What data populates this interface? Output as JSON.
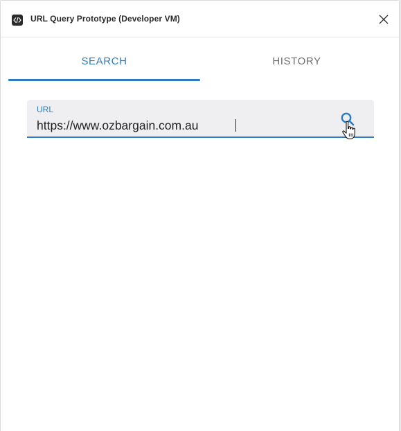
{
  "window": {
    "title": "URL Query Prototype (Developer VM)",
    "icon": "code-icon",
    "close_icon": "close-icon"
  },
  "tabs": [
    {
      "label": "SEARCH",
      "active": true
    },
    {
      "label": "HISTORY",
      "active": false
    }
  ],
  "url_field": {
    "label": "URL",
    "value": "https://www.ozbargain.com.au",
    "search_icon": "search-icon"
  },
  "colors": {
    "accent": "#2c7cc1",
    "inactive_tab": "#6e6e6e",
    "field_bg": "#efeff2"
  }
}
